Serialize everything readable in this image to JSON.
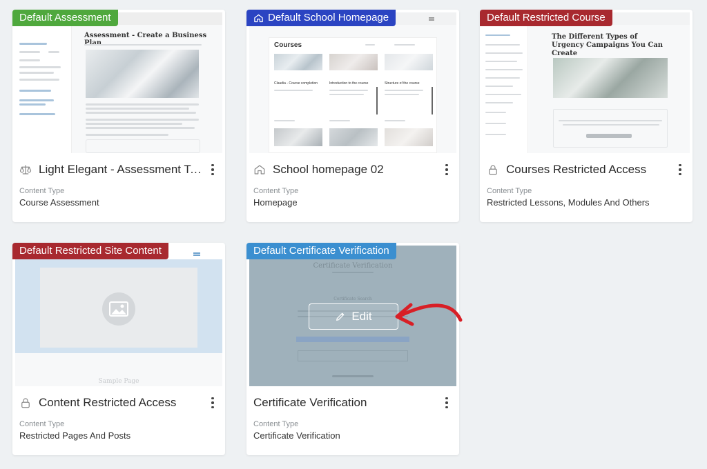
{
  "colors": {
    "badge_green": "#4fa83d",
    "badge_blue": "#2b44c2",
    "badge_red": "#a8292f",
    "badge_lightblue": "#3b8fd0",
    "arrow_red": "#d81f26",
    "overlay": "#9fb1bb"
  },
  "cards": [
    {
      "badge": "Default Assessment",
      "icon": "scale-icon",
      "title": "Light Elegant - Assessment Template",
      "content_type_label": "Content Type",
      "content_type": "Course Assessment",
      "preview": {
        "heading": "Assessment - Create a Business Plan"
      }
    },
    {
      "badge": "Default School Homepage",
      "badge_icon": "home-icon",
      "icon": "home-icon",
      "title": "School homepage 02",
      "content_type_label": "Content Type",
      "content_type": "Homepage",
      "preview": {
        "heading": "Courses",
        "course_titles": [
          "Claudia - Course completion",
          "Introduction to the course",
          "Structure of the course"
        ]
      }
    },
    {
      "badge": "Default Restricted Course",
      "icon": "lock-icon",
      "title": "Courses Restricted Access",
      "content_type_label": "Content Type",
      "content_type": "Restricted Lessons, Modules And Others",
      "preview": {
        "heading": "The Different Types of Urgency Campaigns You Can Create"
      }
    },
    {
      "badge": "Default Restricted Site Content",
      "icon": "lock-icon",
      "title": "Content Restricted Access",
      "content_type_label": "Content Type",
      "content_type": "Restricted Pages And Posts",
      "preview": {
        "caption": "Sample Page"
      }
    },
    {
      "badge": "Default Certificate Verification",
      "title": "Certificate Verification",
      "content_type_label": "Content Type",
      "content_type": "Certificate Verification",
      "preview": {
        "heading": "Certificate Verification",
        "sub": "Certificate Search"
      },
      "edit_label": "Edit"
    }
  ]
}
